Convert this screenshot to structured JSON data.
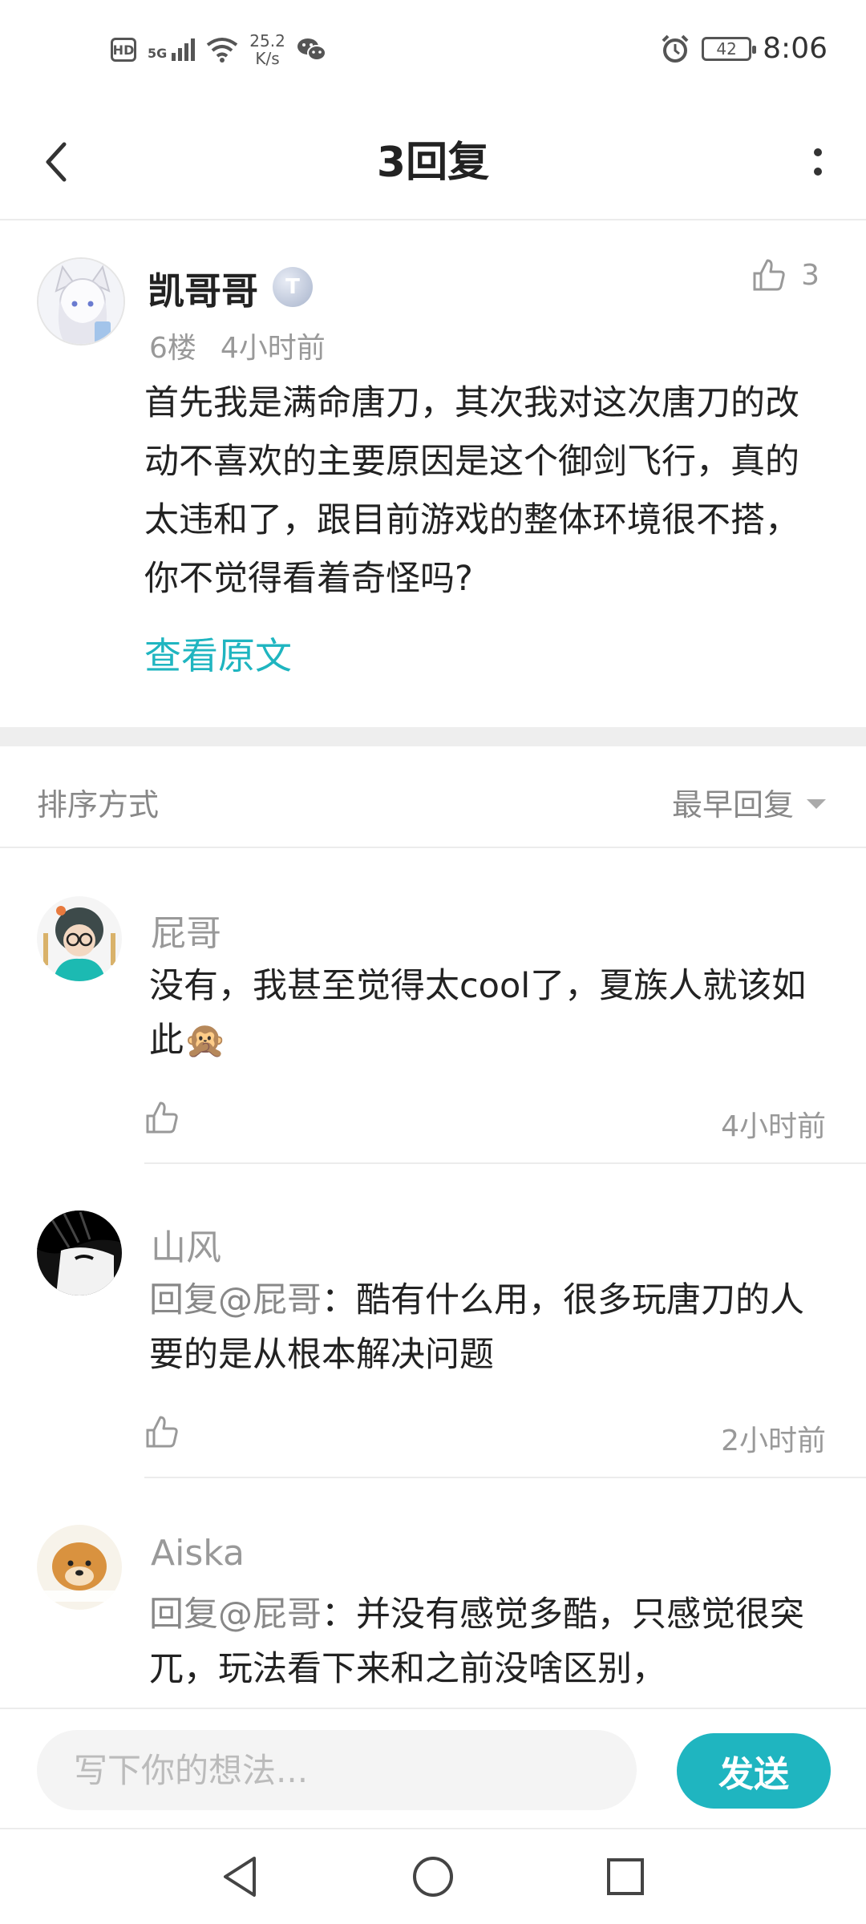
{
  "status_bar": {
    "hd": "HD",
    "signal": "5G",
    "net_speed_value": "25.2",
    "net_speed_unit": "K/s",
    "battery": "42",
    "time": "8:06"
  },
  "header": {
    "title": "3回复"
  },
  "main_comment": {
    "author": "凯哥哥",
    "level_badge": "T",
    "likes": "3",
    "floor": "6楼",
    "time": "4小时前",
    "text": "首先我是满命唐刀，其次我对这次唐刀的改动不喜欢的主要原因是这个御剑飞行，真的太违和了，跟目前游戏的整体环境很不搭，你不觉得看着奇怪吗?",
    "view_original": "查看原文"
  },
  "sort": {
    "label": "排序方式",
    "selected": "最早回复"
  },
  "replies": [
    {
      "author": "屁哥",
      "text": "没有，我甚至觉得太cool了，夏族人就该如此🙊",
      "time": "4小时前"
    },
    {
      "author": "山风",
      "mention": "回复@屁哥",
      "text": "：酷有什么用，很多玩唐刀的人要的是从根本解决问题",
      "time": "2小时前"
    },
    {
      "author": "Aiska",
      "mention": "回复@屁哥",
      "text": "：并没有感觉多酷，只感觉很突兀，玩法看下来和之前没啥区别，"
    }
  ],
  "composer": {
    "placeholder": "写下你的想法...",
    "send_label": "发送"
  },
  "colors": {
    "accent": "#1fb5c0",
    "muted_text": "#999999",
    "divider": "#ececec"
  },
  "icons": [
    "back-arrow-icon",
    "more-vertical-icon",
    "thumb-up-icon",
    "triangle-down-icon",
    "nav-back-icon",
    "nav-home-icon",
    "nav-recents-icon"
  ]
}
